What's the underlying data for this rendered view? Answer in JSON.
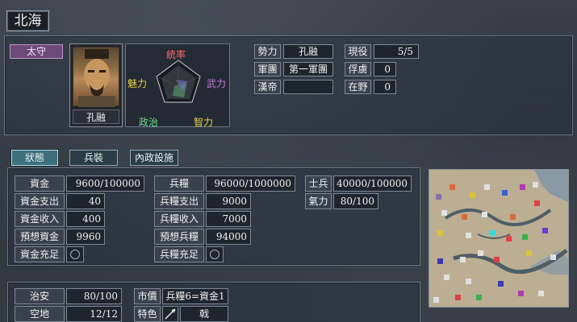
{
  "city": {
    "name": "北海"
  },
  "governor": {
    "role": "太守",
    "name": "孔融",
    "stats_labels": {
      "command": "統率",
      "charisma": "魅力",
      "war": "武力",
      "politics": "政治",
      "intelligence": "智力"
    }
  },
  "info": {
    "force_label": "勢力",
    "force_value": "孔融",
    "corps_label": "軍團",
    "corps_value": "第一軍團",
    "emperor_label": "漢帝",
    "emperor_value": "",
    "active_label": "現役",
    "active_value": "5/5",
    "captive_label": "俘虜",
    "captive_value": "0",
    "idle_label": "在野",
    "idle_value": "0"
  },
  "tabs": [
    {
      "label": "狀態",
      "active": true
    },
    {
      "label": "兵裝",
      "active": false
    },
    {
      "label": "內政設施",
      "active": false
    }
  ],
  "gold": {
    "funds_label": "資金",
    "funds_value": "9600/100000",
    "expense_label": "資金支出",
    "expense_value": "40",
    "income_label": "資金收入",
    "income_value": "400",
    "forecast_label": "預想資金",
    "forecast_value": "9960",
    "sufficient_label": "資金充足"
  },
  "food": {
    "food_label": "兵糧",
    "food_value": "96000/1000000",
    "expense_label": "兵糧支出",
    "expense_value": "9000",
    "income_label": "兵糧收入",
    "income_value": "7000",
    "forecast_label": "預想兵糧",
    "forecast_value": "94000",
    "sufficient_label": "兵糧充足"
  },
  "troops": {
    "soldiers_label": "士兵",
    "soldiers_value": "40000/100000",
    "morale_label": "氣力",
    "morale_value": "80/100"
  },
  "city_stats": {
    "order_label": "治安",
    "order_value": "80/100",
    "land_label": "空地",
    "land_value": "12/12",
    "market_label": "市價",
    "market_value": "兵糧6=資金1",
    "special_label": "特色",
    "special_value": "戟"
  },
  "colors": {
    "accent_tab": "#3d6f7c",
    "role_badge": "#6d4a7a"
  }
}
